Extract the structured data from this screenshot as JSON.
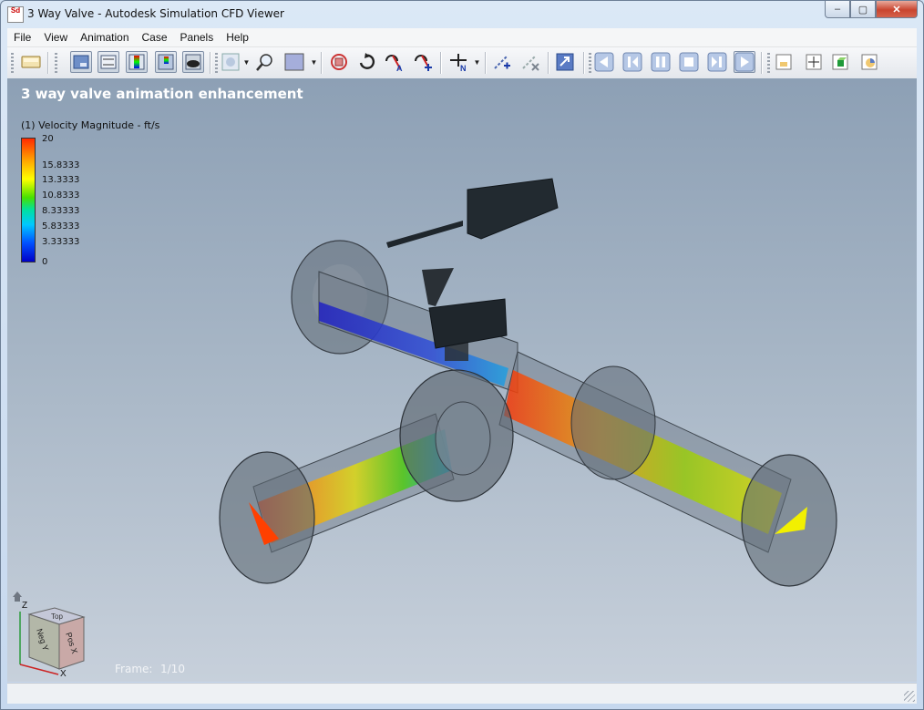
{
  "window": {
    "title": "3 Way Valve - Autodesk Simulation CFD Viewer",
    "app_icon_text": "Sd",
    "controls": {
      "minimize": "–",
      "maximize": "▢",
      "close": "✕"
    }
  },
  "menu": [
    "File",
    "View",
    "Animation",
    "Case",
    "Panels",
    "Help"
  ],
  "toolbar": {
    "buttons": [
      {
        "icon": "open-file-icon",
        "active": false
      },
      {
        "icon": "table-view-icon",
        "active": true
      },
      {
        "icon": "list-view-icon",
        "active": true
      },
      {
        "icon": "color-legend-icon",
        "active": true
      },
      {
        "icon": "results-legend-icon",
        "active": true
      },
      {
        "icon": "shaded-view-icon",
        "active": true
      },
      {
        "icon": "fit-view-icon",
        "active": false
      },
      {
        "icon": "zoom-icon",
        "active": false
      },
      {
        "icon": "background-color-icon",
        "active": false
      },
      {
        "icon": "reset-view-icon",
        "active": false
      },
      {
        "icon": "rotate-icon",
        "active": false
      },
      {
        "icon": "rotate-about-a-icon",
        "active": false
      },
      {
        "icon": "rotate-about-b-icon",
        "active": false
      },
      {
        "icon": "view-normal-icon",
        "active": false
      },
      {
        "icon": "measure-distance-icon",
        "active": false
      },
      {
        "icon": "clear-measure-icon",
        "active": false
      },
      {
        "icon": "export-icon",
        "active": false
      },
      {
        "icon": "first-frame-icon",
        "active": false
      },
      {
        "icon": "step-back-icon",
        "active": false
      },
      {
        "icon": "pause-icon",
        "active": false
      },
      {
        "icon": "stop-icon",
        "active": false
      },
      {
        "icon": "step-forward-icon",
        "active": false
      },
      {
        "icon": "play-icon",
        "active": true
      },
      {
        "icon": "panel-bottom-icon",
        "active": false
      },
      {
        "icon": "panel-cross-icon",
        "active": false
      },
      {
        "icon": "panel-3d-icon",
        "active": false
      },
      {
        "icon": "panel-chart-icon",
        "active": false
      }
    ],
    "n_label": "N"
  },
  "viewport": {
    "title": "3 way valve animation enhancement",
    "legend": {
      "title": "(1) Velocity Magnitude - ft/s",
      "ticks": [
        "20",
        "15.8333",
        "13.3333",
        "10.8333",
        "8.33333",
        "5.83333",
        "3.33333",
        "0"
      ],
      "colors": [
        "#ff2a00",
        "#ffa500",
        "#ffff00",
        "#47e000",
        "#00e0a0",
        "#00c8ff",
        "#0050ff",
        "#0000c8"
      ]
    },
    "nav_cube": {
      "top": "Top",
      "front": "Neg Y",
      "right": "Pos X",
      "axis_z": "Z",
      "axis_x": "X"
    },
    "frame_label": "Frame:",
    "frame_value": "1/10"
  }
}
